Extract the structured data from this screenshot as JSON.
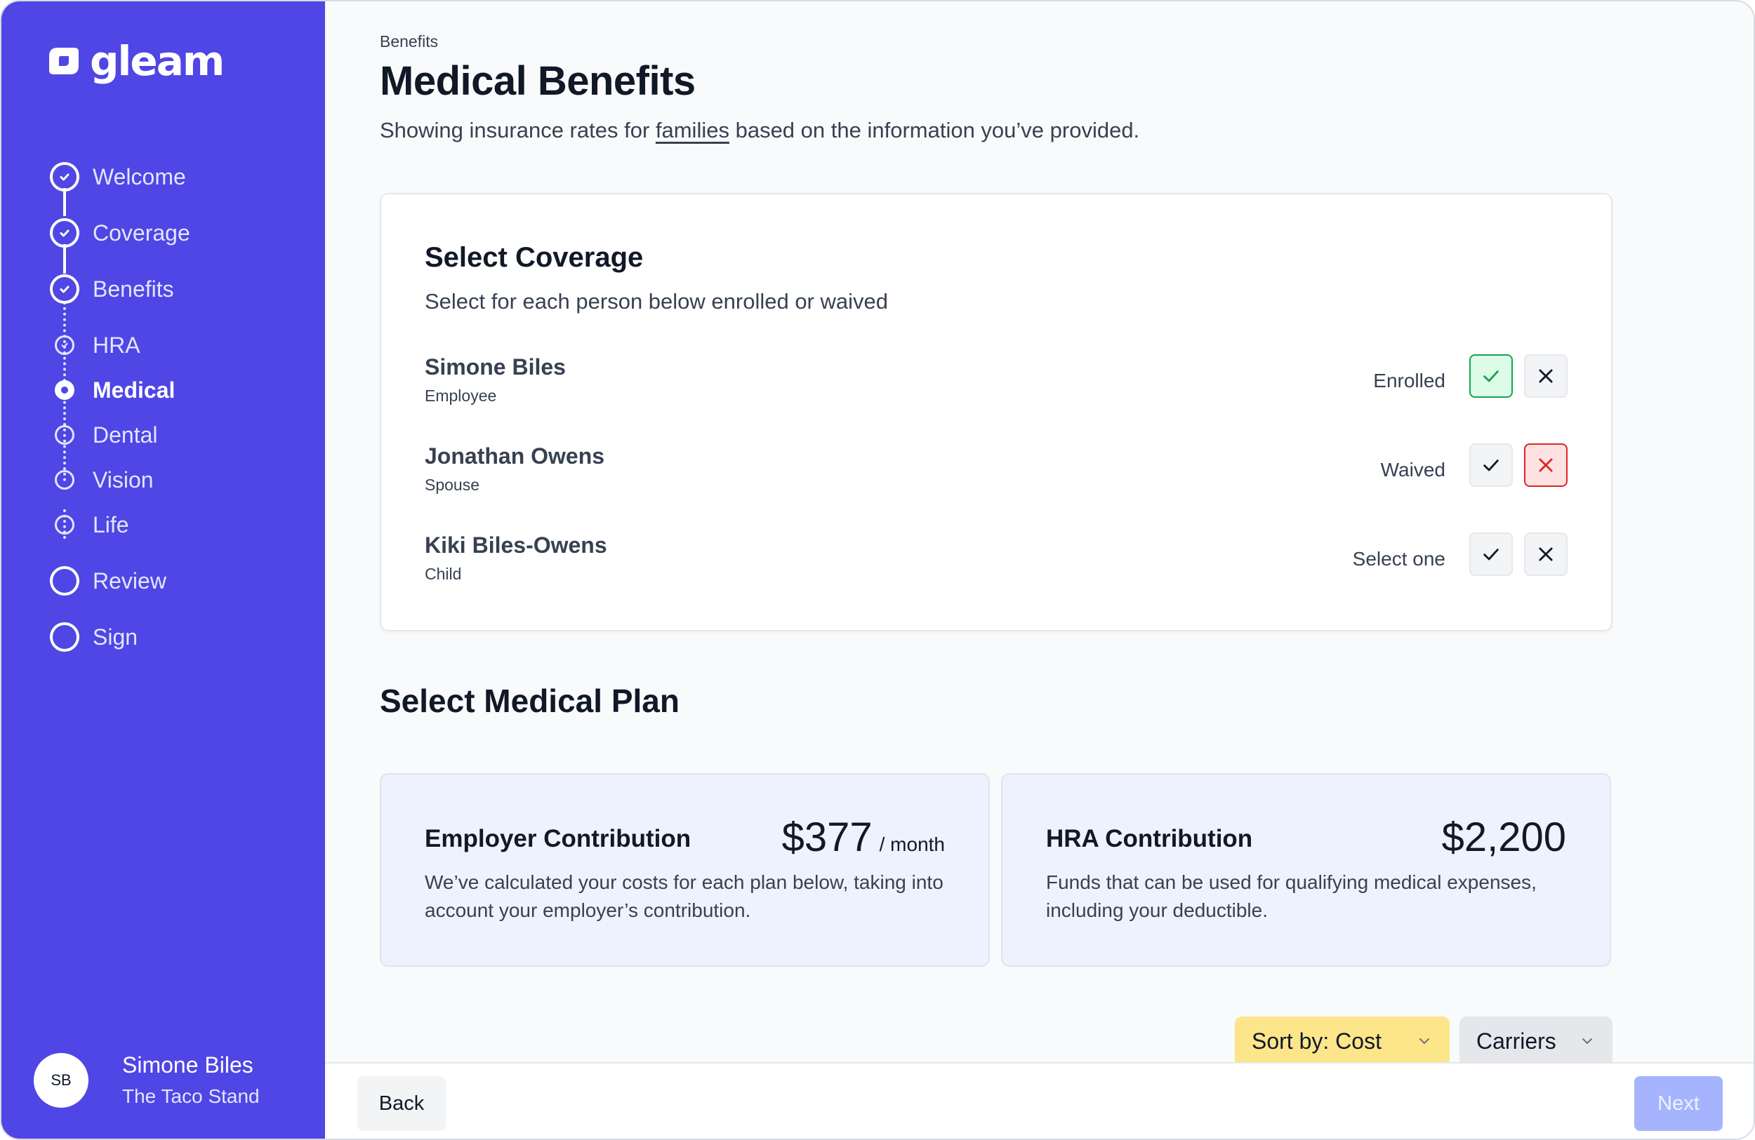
{
  "brand": {
    "name": "gleam",
    "icon": "gleam-logo-icon"
  },
  "steps": [
    {
      "label": "Welcome",
      "state": "complete"
    },
    {
      "label": "Coverage",
      "state": "complete"
    },
    {
      "label": "Benefits",
      "state": "complete"
    },
    {
      "label": "HRA",
      "state": "complete"
    },
    {
      "label": "Medical",
      "state": "current"
    },
    {
      "label": "Dental",
      "state": "upcoming"
    },
    {
      "label": "Vision",
      "state": "upcoming"
    },
    {
      "label": "Life",
      "state": "upcoming"
    },
    {
      "label": "Review",
      "state": "upcoming"
    },
    {
      "label": "Sign",
      "state": "upcoming"
    }
  ],
  "user": {
    "initials": "SB",
    "name": "Simone Biles",
    "company": "The Taco Stand"
  },
  "page": {
    "breadcrumb": "Benefits",
    "title": "Medical Benefits",
    "subtitle_before": "Showing insurance rates for ",
    "subtitle_link": "families",
    "subtitle_after": " based on the information you’ve provided."
  },
  "coverage": {
    "title": "Select Coverage",
    "subtitle": "Select for each person below enrolled or waived",
    "people": [
      {
        "name": "Simone Biles",
        "role": "Employee",
        "status": "Enrolled",
        "selection": "enrolled"
      },
      {
        "name": "Jonathan Owens",
        "role": "Spouse",
        "status": "Waived",
        "selection": "waived"
      },
      {
        "name": "Kiki Biles-Owens",
        "role": "Child",
        "status": "Select one",
        "selection": "none"
      }
    ]
  },
  "plan": {
    "title": "Select Medical Plan",
    "employer": {
      "title": "Employer Contribution",
      "amount": "$377",
      "unit": "/ month",
      "description": "We’ve calculated your costs for each plan below, taking into account your employer’s contribution."
    },
    "hra": {
      "title": "HRA Contribution",
      "amount": "$2,200",
      "description": "Funds that can be used for qualifying medical expenses, including your deductible."
    },
    "sort_label": "Sort by: Cost",
    "carriers_label": "Carriers"
  },
  "footer": {
    "back_label": "Back",
    "next_label": "Next"
  },
  "colors": {
    "sidebar": "#4f46e5",
    "enrolled": "#16a34a",
    "waived": "#dc2626",
    "sort": "#fde68a",
    "next_disabled": "#a5b4fc"
  }
}
